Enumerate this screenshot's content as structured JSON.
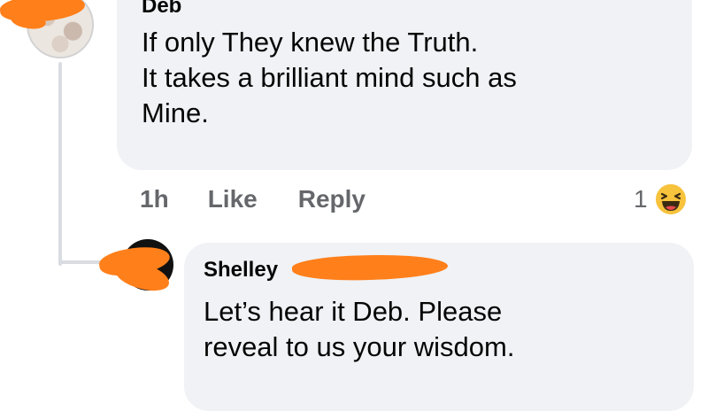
{
  "comments": [
    {
      "author": "Deb",
      "lines": [
        "If only They knew the Truth.",
        "It takes a brilliant mind such as",
        "Mine."
      ],
      "time": "1h",
      "like_label": "Like",
      "reply_label": "Reply",
      "reaction_count": "1",
      "reaction_icon": "haha-reaction-icon"
    },
    {
      "author": "Shelley",
      "lines": [
        "Let’s hear it Deb. Please",
        "reveal to us your wisdom."
      ]
    }
  ],
  "colors": {
    "bubble": "#f0f2f5",
    "meta_text": "#65676b",
    "redaction": "#ff7f1a",
    "haha_yellow": "#f7c23c"
  }
}
